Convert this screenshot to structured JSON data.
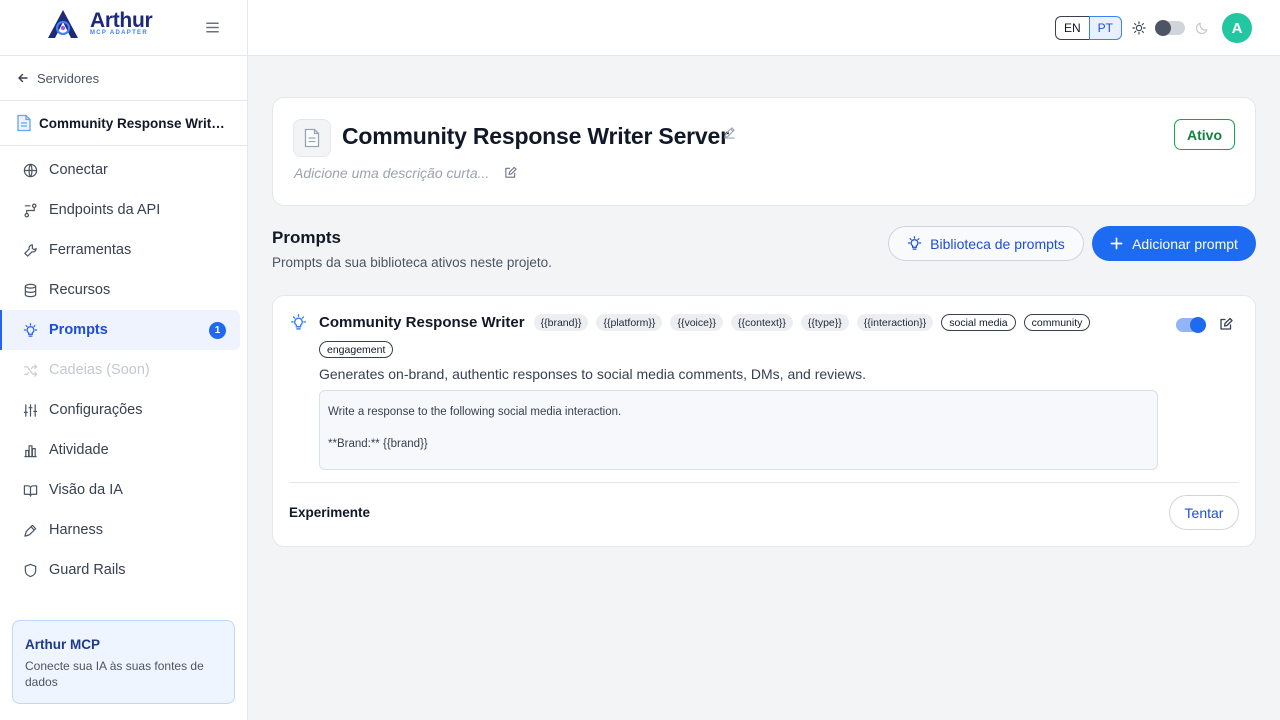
{
  "brand": {
    "name": "Arthur",
    "subtitle": "MCP ADAPTER",
    "accent": "#1d6bf0"
  },
  "sidebar": {
    "back_label": "Servidores",
    "server_name": "Community Response Writer Server",
    "items": [
      {
        "label": "Conectar",
        "icon": "globe-icon"
      },
      {
        "label": "Endpoints da API",
        "icon": "route-icon"
      },
      {
        "label": "Ferramentas",
        "icon": "wrench-icon"
      },
      {
        "label": "Recursos",
        "icon": "database-icon"
      },
      {
        "label": "Prompts",
        "icon": "lightbulb-icon",
        "active": true,
        "badge": "1"
      },
      {
        "label": "Cadeias (Soon)",
        "icon": "shuffle-icon",
        "disabled": true
      },
      {
        "label": "Configurações",
        "icon": "sliders-icon"
      },
      {
        "label": "Atividade",
        "icon": "bar-chart-icon"
      },
      {
        "label": "Visão da IA",
        "icon": "book-open-icon"
      },
      {
        "label": "Harness",
        "icon": "pen-tool-icon"
      },
      {
        "label": "Guard Rails",
        "icon": "shield-icon"
      }
    ],
    "card": {
      "title": "Arthur MCP",
      "description": "Conecte sua IA às suas fontes de dados"
    }
  },
  "header": {
    "languages": [
      "EN",
      "PT"
    ],
    "active_language": "PT",
    "avatar_initial": "A",
    "avatar_color": "#22c7a1"
  },
  "server": {
    "title": "Community Response Writer Server",
    "description_placeholder": "Adicione uma descrição curta...",
    "status": "Ativo",
    "status_color": "#16a34a"
  },
  "prompts_section": {
    "title": "Prompts",
    "subtitle": "Prompts da sua biblioteca ativos neste projeto.",
    "library_button": "Biblioteca de prompts",
    "add_button": "Adicionar prompt"
  },
  "prompt": {
    "name": "Community Response Writer",
    "variables": [
      "{{brand}}",
      "{{platform}}",
      "{{voice}}",
      "{{context}}",
      "{{type}}",
      "{{interaction}}"
    ],
    "tags": [
      "social media",
      "community",
      "engagement"
    ],
    "enabled": true,
    "description": "Generates on-brand, authentic responses to social media comments, DMs, and reviews.",
    "content_lines": [
      "Write a response to the following social media interaction.",
      "",
      "**Brand:** {{brand}}"
    ],
    "try_label": "Experimente",
    "try_button": "Tentar"
  }
}
